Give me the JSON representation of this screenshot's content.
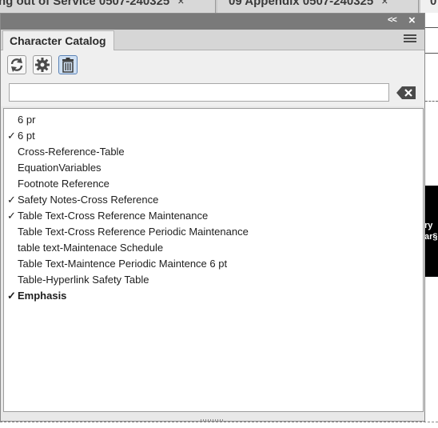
{
  "doc_tabs": [
    {
      "label": "ng out of Service 0507-240325",
      "close": "×"
    },
    {
      "label": "09 Appendix 0507-240325",
      "close": "×"
    },
    {
      "label": "0"
    }
  ],
  "background_doc": {
    "black_line1": "ry",
    "black_line2": "ar§"
  },
  "panel": {
    "collapse": "<<",
    "close": "×",
    "tab_label": "Character Catalog",
    "menu_icon": "hamburger-menu-icon",
    "toolbar": {
      "refresh_icon": "refresh-icon",
      "settings_icon": "gear-icon",
      "delete_icon": "trash-icon"
    },
    "search": {
      "value": "",
      "placeholder": ""
    },
    "clear_icon": "clear-search-icon",
    "checkmark": "✓",
    "items": [
      {
        "label": "6 pr",
        "checked": false,
        "bold": false
      },
      {
        "label": "6 pt",
        "checked": true,
        "bold": false
      },
      {
        "label": "Cross-Reference-Table",
        "checked": false,
        "bold": false
      },
      {
        "label": "EquationVariables",
        "checked": false,
        "bold": false
      },
      {
        "label": "Footnote Reference",
        "checked": false,
        "bold": false
      },
      {
        "label": "Safety Notes-Cross Reference",
        "checked": true,
        "bold": false
      },
      {
        "label": "Table Text-Cross Reference Maintenance",
        "checked": true,
        "bold": false
      },
      {
        "label": "Table Text-Cross Reference Periodic Maintenance",
        "checked": false,
        "bold": false
      },
      {
        "label": "table text-Maintenace Schedule",
        "checked": false,
        "bold": false
      },
      {
        "label": "Table Text-Maintence Periodic Maintence 6 pt",
        "checked": false,
        "bold": false
      },
      {
        "label": "Table-Hyperlink Safety Table",
        "checked": false,
        "bold": false
      },
      {
        "label": "Emphasis",
        "checked": true,
        "bold": true
      }
    ]
  }
}
